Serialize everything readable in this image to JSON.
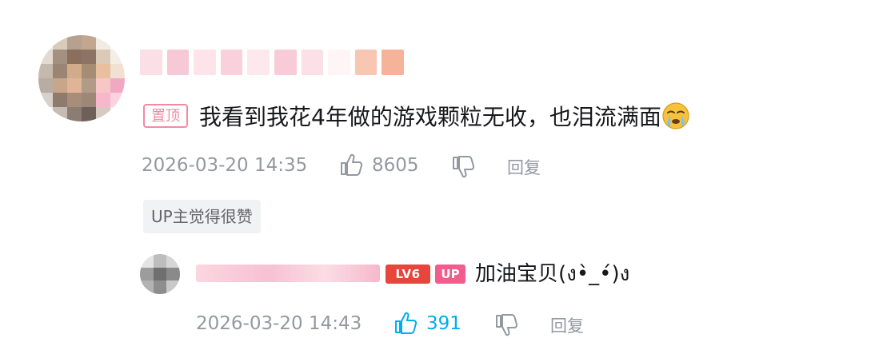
{
  "comment": {
    "pin_label": "置顶",
    "text": "我看到我花4年做的游戏颗粒无收，也泪流满面",
    "emoji": "crying-face-icon",
    "timestamp": "2026-03-20 14:35",
    "likes": "8605",
    "reply_label": "回复",
    "up_liked_label": "UP主觉得很赞"
  },
  "reply": {
    "level_badge": "LV6",
    "up_badge": "UP",
    "text": "加油宝贝(ง•̀_•́)ง",
    "timestamp": "2026-03-20 14:43",
    "likes": "391",
    "reply_label": "回复"
  },
  "colors": {
    "pin": "#f38aa4",
    "meta": "#9499a0",
    "like_active": "#00aeec",
    "level_badge": "#e8453c",
    "up_badge": "#f25d8e"
  }
}
